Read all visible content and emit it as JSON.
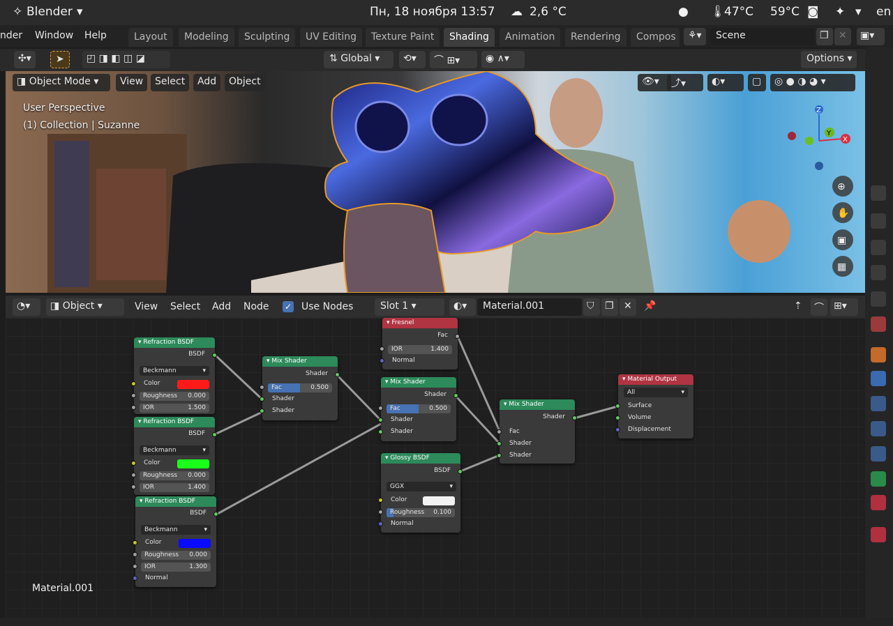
{
  "system_bar": {
    "app_name": "Blender",
    "datetime": "Пн, 18 ноября  13:57",
    "weather": "2,6 °C",
    "temp1": "47°C",
    "temp2": "59°C",
    "lang": "en"
  },
  "header": {
    "menus": [
      "nder",
      "Window",
      "Help"
    ],
    "tabs": [
      "Layout",
      "Modeling",
      "Sculpting",
      "UV Editing",
      "Texture Paint",
      "Shading",
      "Animation",
      "Rendering",
      "Compos"
    ],
    "active_tab": "Shading",
    "scene": "Scene"
  },
  "viewport_toolbar": {
    "transform_orientation": "Global",
    "options_label": "Options"
  },
  "viewport": {
    "mode": "Object Mode",
    "menus": [
      "View",
      "Select",
      "Add",
      "Object"
    ],
    "perspective_text": "User Perspective",
    "collection_text": "(1) Collection | Suzanne",
    "gizmo": {
      "z": "Z",
      "y": "Y",
      "x": "X"
    }
  },
  "node_editor": {
    "editor_type": "Object",
    "menus": [
      "View",
      "Select",
      "Add",
      "Node"
    ],
    "use_nodes_label": "Use Nodes",
    "slot": "Slot 1",
    "material_name": "Material.001",
    "canvas_label": "Material.001"
  },
  "nodes": {
    "refraction1": {
      "title": "Refraction BSDF",
      "output": "BSDF",
      "distribution": "Beckmann",
      "color_label": "Color",
      "color": "#ff1a1a",
      "roughness_label": "Roughness",
      "roughness": "0.000",
      "ior_label": "IOR",
      "ior": "1.500"
    },
    "refraction2": {
      "title": "Refraction BSDF",
      "output": "BSDF",
      "distribution": "Beckmann",
      "color_label": "Color",
      "color": "#1aff1a",
      "roughness_label": "Roughness",
      "roughness": "0.000",
      "ior_label": "IOR",
      "ior": "1.400"
    },
    "refraction3": {
      "title": "Refraction BSDF",
      "output": "BSDF",
      "distribution": "Beckmann",
      "color_label": "Color",
      "color": "#0a0aff",
      "roughness_label": "Roughness",
      "roughness": "0.000",
      "ior_label": "IOR",
      "ior": "1.300",
      "normal_label": "Normal"
    },
    "mix1": {
      "title": "Mix Shader",
      "output": "Shader",
      "fac_label": "Fac",
      "fac": "0.500",
      "in1": "Shader",
      "in2": "Shader"
    },
    "fresnel": {
      "title": "Fresnel",
      "output": "Fac",
      "ior_label": "IOR",
      "ior": "1.400",
      "normal_label": "Normal"
    },
    "mix2": {
      "title": "Mix Shader",
      "output": "Shader",
      "fac_label": "Fac",
      "fac": "0.500",
      "in1": "Shader",
      "in2": "Shader"
    },
    "glossy": {
      "title": "Glossy BSDF",
      "output": "BSDF",
      "distribution": "GGX",
      "color_label": "Color",
      "color": "#f2f2f2",
      "roughness_label": "Roughness",
      "roughness": "0.100",
      "normal_label": "Normal"
    },
    "mix3": {
      "title": "Mix Shader",
      "output": "Shader",
      "fac_label": "Fac",
      "in1": "Shader",
      "in2": "Shader"
    },
    "output": {
      "title": "Material Output",
      "target": "All",
      "surface": "Surface",
      "volume": "Volume",
      "displacement": "Displacement"
    }
  },
  "colors": {
    "accent": "#4772b3",
    "node_green": "#2d8a5a",
    "node_red": "#b03442"
  }
}
